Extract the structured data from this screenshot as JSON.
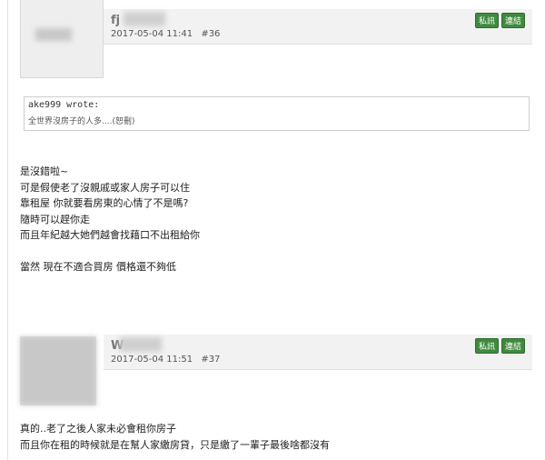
{
  "posts": [
    {
      "username": "fj",
      "date": "2017-05-04 11:41",
      "number": "#36",
      "btn_pm": "私訊",
      "btn_link": "連結"
    },
    {
      "username": "W",
      "date": "2017-05-04 11:51",
      "number": "#37",
      "btn_pm": "私訊",
      "btn_link": "連結"
    }
  ],
  "quote": {
    "author": "ake999 wrote:",
    "text": "全世界沒房子的人多....(恕刪)"
  },
  "reply1": [
    "是沒錯啦~",
    "可是假使老了沒親戚或家人房子可以住",
    "靠租屋 你就要看房東的心情了不是嗎?",
    "隨時可以趕你走",
    "而且年紀越大她們越會找藉口不出租給你",
    "",
    "當然 現在不適合買房 價格還不夠低"
  ],
  "reply2": [
    "真的..老了之後人家未必會租你房子",
    "而且你在租的時候就是在幫人家繳房貸，只是繳了一輩子最後啥都沒有"
  ]
}
